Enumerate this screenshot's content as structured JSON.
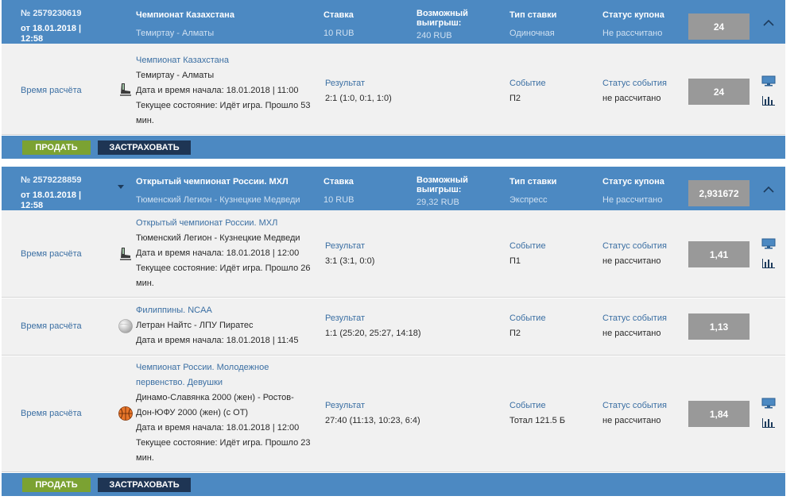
{
  "labels": {
    "stake": "Ставка",
    "possible_win": "Возможный выигрыш:",
    "bet_type": "Тип ставки",
    "coupon_status": "Статус купона",
    "calc_time": "Время расчёта",
    "result": "Результат",
    "event": "Событие",
    "event_status": "Статус события",
    "sell": "ПРОДАТЬ",
    "insure": "ЗАСТРАХОВАТЬ"
  },
  "coupons": [
    {
      "number": "№ 2579230619",
      "date": "от 18.01.2018 | 12:58",
      "championship": "Чемпионат Казахстана",
      "match": "Темиртау - Алматы",
      "stake": "10 RUB",
      "possible_win": "240 RUB",
      "bet_type": "Одиночная",
      "coupon_status": "Не рассчитано",
      "coefficient": "24",
      "events": [
        {
          "championship": "Чемпионат Казахстана",
          "match": "Темиртау - Алматы",
          "start": "Дата и время начала: 18.01.2018 | 11:00",
          "state": "Текущее состояние: Идёт игра. Прошло 53 мин.",
          "sport_icon": "hockey-skate-icon",
          "result": "2:1 (1:0, 0:1, 1:0)",
          "event": "П2",
          "event_status": "не рассчитано",
          "coefficient": "24"
        }
      ]
    },
    {
      "number": "№ 2579228859",
      "date": "от 18.01.2018 | 12:58",
      "championship": "Открытый чемпионат России. МХЛ",
      "match": "Тюменский Легион - Кузнецкие Медведи",
      "stake": "10 RUB",
      "possible_win": "29,32 RUB",
      "bet_type": "Экспресс",
      "coupon_status": "Не рассчитано",
      "coefficient": "2,931672",
      "events": [
        {
          "championship": "Открытый чемпионат России. МХЛ",
          "match": "Тюменский Легион - Кузнецкие Медведи",
          "start": "Дата и время начала: 18.01.2018 | 12:00",
          "state": "Текущее состояние: Идёт игра. Прошло 26 мин.",
          "sport_icon": "hockey-skate-icon",
          "result": "3:1 (3:1, 0:0)",
          "event": "П1",
          "event_status": "не рассчитано",
          "coefficient": "1,41"
        },
        {
          "championship": "Филиппины. NCAA",
          "match": "Летран Найтс - ЛПУ Пиратес",
          "start": "Дата и время начала: 18.01.2018 | 11:45",
          "sport_icon": "volleyball-icon",
          "result": "1:1 (25:20, 25:27, 14:18)",
          "event": "П2",
          "event_status": "не рассчитано",
          "coefficient": "1,13"
        },
        {
          "championship": "Чемпионат России. Молодежное первенство. Девушки",
          "match": "Динамо-Славянка 2000 (жен) - Ростов-Дон-ЮФУ 2000 (жен) (с ОТ)",
          "start": "Дата и время начала: 18.01.2018 | 12:00",
          "state": "Текущее состояние: Идёт игра. Прошло 23 мин.",
          "sport_icon": "basketball-icon",
          "result": "27:40 (11:13, 10:23, 6:4)",
          "event": "Тотал 121.5 Б",
          "event_status": "не рассчитано",
          "coefficient": "1,84"
        }
      ]
    }
  ]
}
